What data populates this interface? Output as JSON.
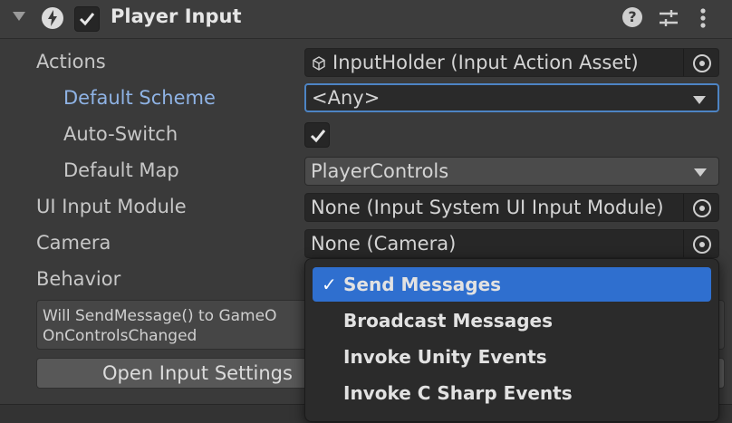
{
  "component": {
    "title": "Player Input"
  },
  "fields": {
    "actions": {
      "label": "Actions",
      "value": "InputHolder (Input Action Asset)"
    },
    "default_scheme": {
      "label": "Default Scheme",
      "value": "<Any>"
    },
    "auto_switch": {
      "label": "Auto-Switch",
      "checked": true
    },
    "default_map": {
      "label": "Default Map",
      "value": "PlayerControls"
    },
    "ui_input_module": {
      "label": "UI Input Module",
      "value": "None (Input System UI Input Module)"
    },
    "camera": {
      "label": "Camera",
      "value": "None (Camera)"
    },
    "behavior": {
      "label": "Behavior"
    }
  },
  "help_text": {
    "line1": "Will SendMessage() to GameO",
    "line2": "OnControlsChanged"
  },
  "open_settings_button": "Open Input Settings",
  "behavior_menu": {
    "selected_index": 0,
    "items": [
      "Send Messages",
      "Broadcast Messages",
      "Invoke Unity Events",
      "Invoke C Sharp Events"
    ]
  },
  "icons": {
    "foldout": "triangle-down-icon",
    "component": "lightning-bolt-icon",
    "help": "help-icon",
    "presets": "sliders-icon",
    "menu": "kebab-icon",
    "object_picker": "target-icon",
    "asset": "cube-icon"
  },
  "colors": {
    "selection": "#2f6fcf",
    "highlight_label": "#8fb3e5",
    "focus_border": "#4d84c4"
  }
}
